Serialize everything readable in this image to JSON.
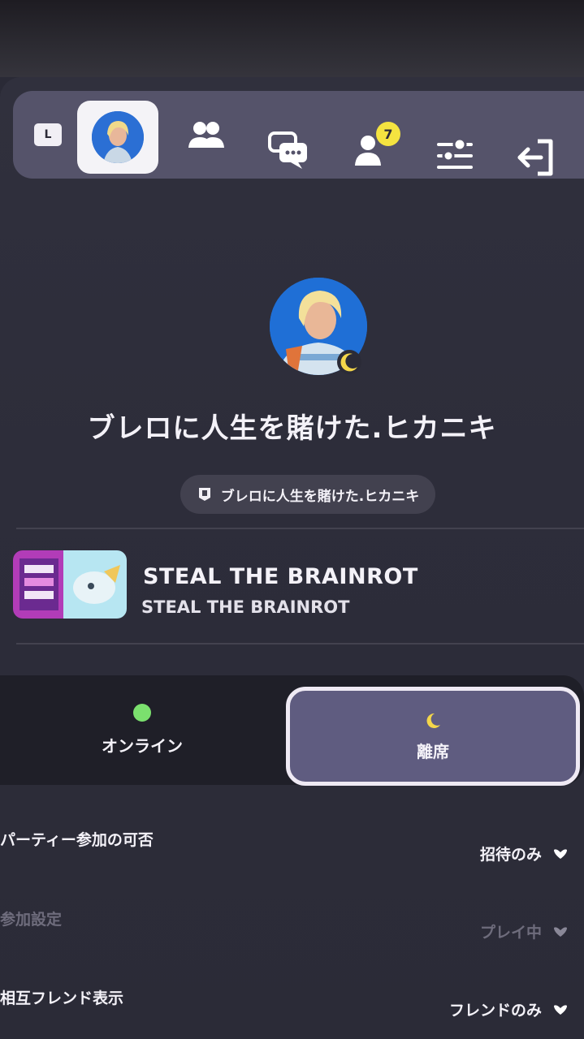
{
  "topbar": {
    "level_badge": "L",
    "notification_count": "7",
    "tabs": [
      {
        "icon": "avatar-icon"
      },
      {
        "icon": "friends-icon"
      },
      {
        "icon": "chat-icon"
      },
      {
        "icon": "friend-requests-icon"
      },
      {
        "icon": "settings-icon"
      },
      {
        "icon": "exit-icon"
      }
    ]
  },
  "profile": {
    "display_name": "ブレロに人生を賭けた.ヒカニキ",
    "epic_name": "ブレロに人生を賭けた.ヒカニキ"
  },
  "game": {
    "title": "STEAL THE BRAINROT",
    "subtitle": "STEAL THE BRAINROT"
  },
  "status": {
    "online_label": "オンライン",
    "away_label": "離席",
    "online_color": "#7be06e",
    "away_color": "#f4d64a"
  },
  "settings": [
    {
      "label": "パーティー参加の可否",
      "value": "招待のみ"
    },
    {
      "label": "参加設定",
      "value": "プレイ中"
    },
    {
      "label": "相互フレンド表示",
      "value": "フレンドのみ"
    }
  ],
  "accent": "#5f5c80"
}
